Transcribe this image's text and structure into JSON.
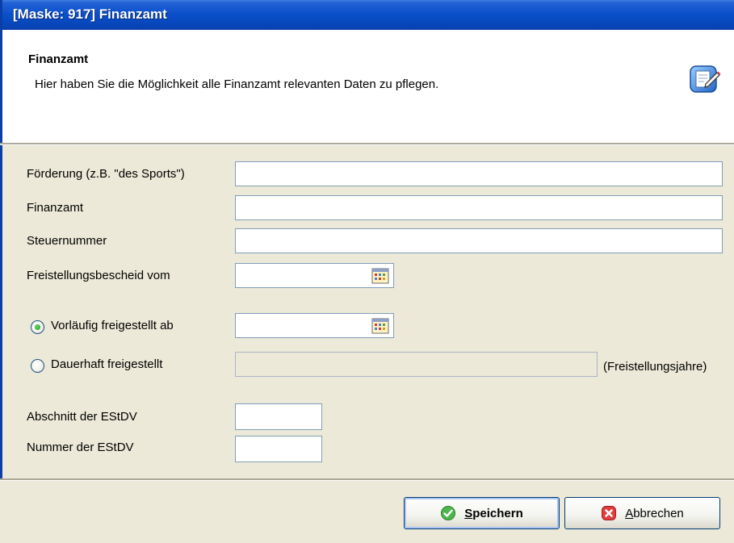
{
  "window": {
    "title": "[Maske: 917] Finanzamt"
  },
  "header": {
    "title": "Finanzamt",
    "description": "Hier haben Sie die Möglichkeit alle Finanzamt relevanten Daten zu pflegen.",
    "icon": "edit-document-icon"
  },
  "form": {
    "foerderung": {
      "label": "Förderung (z.B. \"des Sports\")",
      "value": ""
    },
    "finanzamt": {
      "label": "Finanzamt",
      "value": ""
    },
    "steuernummer": {
      "label": "Steuernummer",
      "value": ""
    },
    "freistellungsbescheid": {
      "label": "Freistellungsbescheid vom",
      "value": ""
    },
    "vorlaeufig": {
      "label": "Vorläufig freigestellt ab",
      "selected": true,
      "value": ""
    },
    "dauerhaft": {
      "label": "Dauerhaft freigestellt",
      "selected": false,
      "value": "",
      "suffix": "(Freistellungsjahre)"
    },
    "abschnitt": {
      "label": "Abschnitt der EStDV",
      "value": ""
    },
    "nummer": {
      "label": "Nummer der EStDV",
      "value": ""
    }
  },
  "buttons": {
    "save": {
      "label": "Speichern",
      "mnemonic": "S",
      "icon": "check-icon"
    },
    "cancel": {
      "label": "Abbrechen",
      "mnemonic": "A",
      "icon": "cancel-icon"
    }
  },
  "colors": {
    "titlebar": "#0A4FC8",
    "window_bg": "#ECE9D8",
    "input_border": "#7F9DB9",
    "radio_selected": "#1E9A1E"
  }
}
